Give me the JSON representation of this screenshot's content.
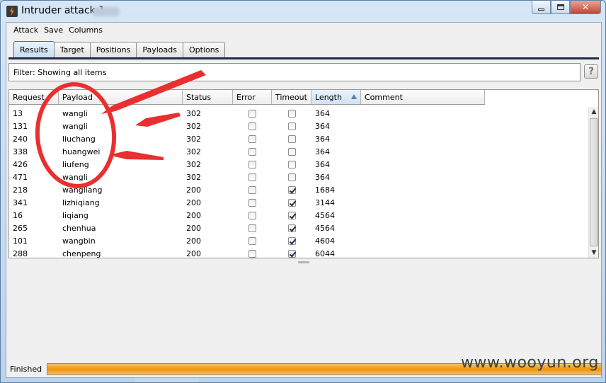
{
  "window": {
    "title": "Intruder attack 1",
    "close_glyph": "✕"
  },
  "menu": [
    "Attack",
    "Save",
    "Columns"
  ],
  "tabs": [
    {
      "label": "Results",
      "active": true
    },
    {
      "label": "Target",
      "active": false
    },
    {
      "label": "Positions",
      "active": false
    },
    {
      "label": "Payloads",
      "active": false
    },
    {
      "label": "Options",
      "active": false
    }
  ],
  "filter": {
    "text": "Filter:  Showing all items",
    "help_glyph": "?"
  },
  "table": {
    "columns": [
      "Request",
      "Payload",
      "Status",
      "Error",
      "Timeout",
      "Length",
      "Comment"
    ],
    "sorted_column": "Length",
    "sort_direction": "ascending",
    "rows": [
      {
        "request": "13",
        "payload": "wangli",
        "status": "302",
        "error": false,
        "timeout": false,
        "length": "364",
        "comment": ""
      },
      {
        "request": "131",
        "payload": "wangli",
        "status": "302",
        "error": false,
        "timeout": false,
        "length": "364",
        "comment": ""
      },
      {
        "request": "240",
        "payload": "liuchang",
        "status": "302",
        "error": false,
        "timeout": false,
        "length": "364",
        "comment": ""
      },
      {
        "request": "338",
        "payload": "huangwei",
        "status": "302",
        "error": false,
        "timeout": false,
        "length": "364",
        "comment": ""
      },
      {
        "request": "426",
        "payload": "liufeng",
        "status": "302",
        "error": false,
        "timeout": false,
        "length": "364",
        "comment": ""
      },
      {
        "request": "471",
        "payload": "wangli",
        "status": "302",
        "error": false,
        "timeout": false,
        "length": "364",
        "comment": ""
      },
      {
        "request": "218",
        "payload": "wangliang",
        "status": "200",
        "error": false,
        "timeout": true,
        "length": "1684",
        "comment": ""
      },
      {
        "request": "341",
        "payload": "lizhiqiang",
        "status": "200",
        "error": false,
        "timeout": true,
        "length": "3144",
        "comment": ""
      },
      {
        "request": "16",
        "payload": "liqiang",
        "status": "200",
        "error": false,
        "timeout": true,
        "length": "4564",
        "comment": ""
      },
      {
        "request": "265",
        "payload": "chenhua",
        "status": "200",
        "error": false,
        "timeout": true,
        "length": "4564",
        "comment": ""
      },
      {
        "request": "101",
        "payload": "wangbin",
        "status": "200",
        "error": false,
        "timeout": true,
        "length": "4604",
        "comment": ""
      },
      {
        "request": "288",
        "payload": "chenpeng",
        "status": "200",
        "error": false,
        "timeout": true,
        "length": "6044",
        "comment": ""
      }
    ]
  },
  "scrollbar": {
    "up_glyph": "▲",
    "down_glyph": "▼"
  },
  "status": {
    "label": "Finished",
    "progress_fraction": 1.0
  },
  "watermark": "www.wooyun.org",
  "colors": {
    "annotation_red": "#ea2f2f",
    "progress_orange": "#f09a14",
    "tab_rule": "#1f2d44"
  },
  "icons": [
    "app-lightning-icon",
    "minimize-icon",
    "maximize-icon",
    "close-icon",
    "help-icon",
    "sort-ascending-icon",
    "scroll-up-icon",
    "scroll-down-icon",
    "checkbox-checked-icon",
    "checkbox-unchecked-icon"
  ]
}
